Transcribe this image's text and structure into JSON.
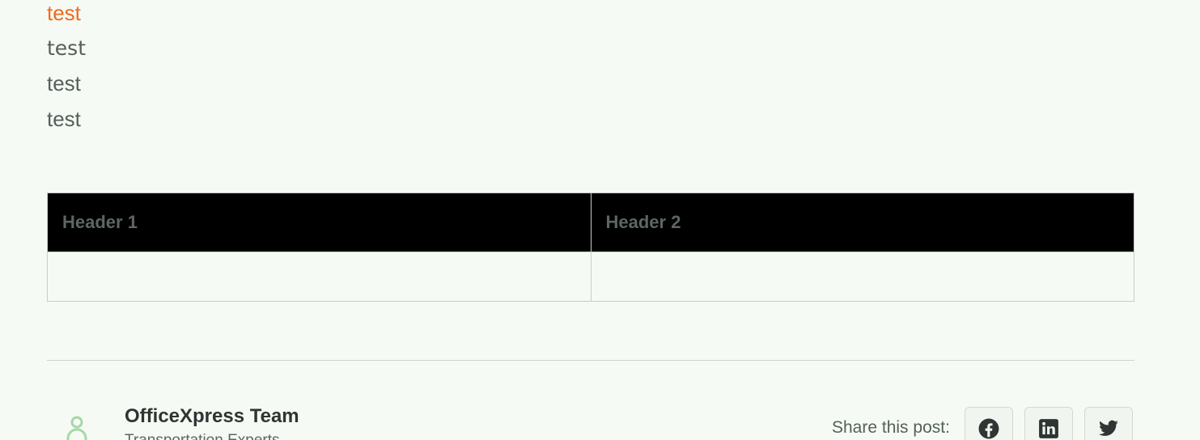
{
  "content": {
    "lines": [
      "test",
      "test",
      "test",
      "test"
    ]
  },
  "table": {
    "headers": [
      "Header 1",
      "Header 2"
    ],
    "rows": [
      [
        "",
        ""
      ]
    ]
  },
  "author": {
    "name": "OfficeXpress Team",
    "role": "Transportation Experts"
  },
  "share": {
    "label": "Share this post:",
    "buttons": [
      {
        "icon": "facebook-icon"
      },
      {
        "icon": "linkedin-icon"
      },
      {
        "icon": "twitter-icon"
      }
    ]
  },
  "colors": {
    "accent": "#f26a1b",
    "background": "#f6faf5",
    "header_bg": "#000000",
    "avatar": "#a7d8a8"
  }
}
